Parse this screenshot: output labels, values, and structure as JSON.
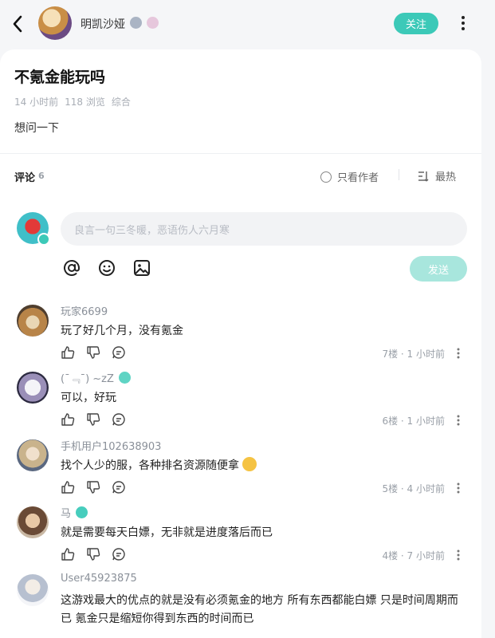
{
  "header": {
    "author_name": "明凯沙娅",
    "follow_label": "关注"
  },
  "post": {
    "title": "不氪金能玩吗",
    "meta": [
      "14 小时前",
      "118 浏览",
      "综合"
    ],
    "body": "想问一下"
  },
  "comments_bar": {
    "label": "评论",
    "count": "6",
    "author_only_label": "只看作者",
    "sort_label": "最热"
  },
  "composer": {
    "placeholder": "良言一句三冬暖，恶语伤人六月寒",
    "send_label": "发送"
  },
  "comments": [
    {
      "user": "玩家6699",
      "text": "玩了好几个月，没有氪金",
      "floor": "7楼 · 1 小时前"
    },
    {
      "user": "(ˉ﹃ˉ) ~zZ",
      "text": "可以，好玩",
      "floor": "6楼 · 1 小时前"
    },
    {
      "user": "手机用户102638903",
      "text": "找个人少的服，各种排名资源随便拿",
      "floor": "5楼 · 4 小时前"
    },
    {
      "user": "马",
      "text": "就是需要每天白嫖，无非就是进度落后而已",
      "floor": "4楼 · 7 小时前"
    },
    {
      "user": "User45923875",
      "text": "这游戏最大的优点的就是没有必须氪金的地方 所有东西都能白嫖 只是时间周期而已 氪金只是缩短你得到东西的时间而已",
      "floor": ""
    }
  ],
  "colors": {
    "accent": "#3cc9b8",
    "send_disabled": "#a8e6dd"
  }
}
